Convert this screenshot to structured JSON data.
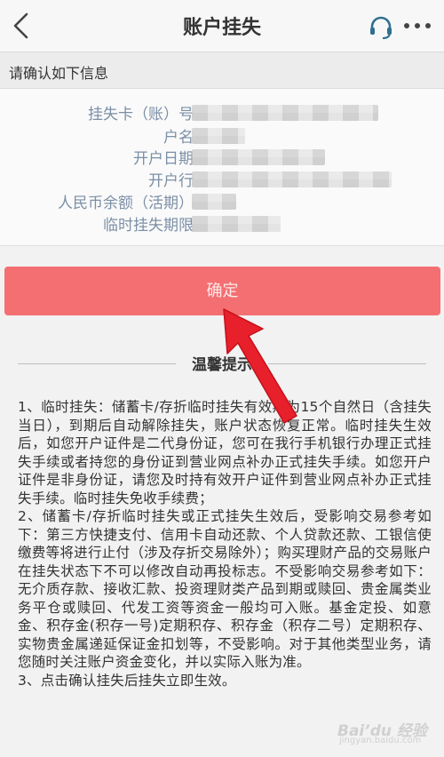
{
  "header": {
    "title": "账户挂失",
    "back_icon": "chevron-left-icon",
    "service_icon": "headset-icon",
    "more_icon": "more-dots-icon"
  },
  "subheader": {
    "text": "请确认如下信息"
  },
  "info": {
    "rows": [
      {
        "label": "挂失卡（账）号"
      },
      {
        "label": "户名"
      },
      {
        "label": "开户日期"
      },
      {
        "label": "开户行"
      },
      {
        "label": "人民币余额（活期）"
      },
      {
        "label": "临时挂失期限"
      }
    ]
  },
  "confirm_button": {
    "label": "确定"
  },
  "tips": {
    "title": "温馨提示",
    "paragraphs": [
      "1、临时挂失：储蓄卡/存折临时挂失有效期为15个自然日（含挂失当日），到期后自动解除挂失，账户状态恢复正常。临时挂失生效后，如您开户证件是二代身份证，您可在我行手机银行办理正式挂失手续或者持您的身份证到营业网点补办正式挂失手续。如您开户证件是非身份证，请您及时持有效开户证件到营业网点补办正式挂失手续。临时挂失免收手续费；",
      "2、储蓄卡/存折临时挂失或正式挂失生效后，受影响交易参考如下：第三方快捷支付、信用卡自动还款、个人贷款还款、工银信使缴费等将进行止付（涉及存折交易除外）；购买理财产品的交易账户在挂失状态下不可以修改自动再投标志。不受影响交易参考如下：无介质存款、接收汇款、投资理财类产品到期或赎回、贵金属类业务平仓或赎回、代发工资等资金一般均可入账。基金定投、如意金、积存金(积存一号)定期积存、积存金（积存二号）定期积存、实物贵金属递延保证金扣划等，不受影响。对于其他类型业务，请您随时关注账户资金变化，并以实际入账为准。",
      "3、点击确认挂失后挂失立即生效。"
    ]
  },
  "watermark": {
    "text": "Bai’du 经验",
    "sub": "jingyan.baidu.com"
  },
  "colors": {
    "confirm_bg": "#f46f72",
    "label": "#7b8fa6",
    "arrow": "#e8202c"
  }
}
